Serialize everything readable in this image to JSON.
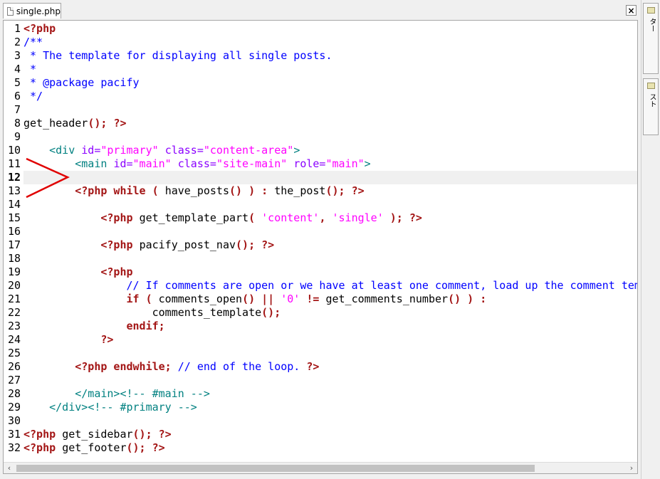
{
  "tab": {
    "filename": "single.php",
    "icon": "file-icon",
    "close_label": "×"
  },
  "side_panel": {
    "tabs": [
      {
        "label": "ファイルセレクター",
        "icon": "folder-icon"
      },
      {
        "label": "ファイルリスト",
        "icon": "folder-icon"
      }
    ]
  },
  "editor": {
    "current_line": 12,
    "annotation": {
      "shape": "red-arrow-pointing-right",
      "color": "#e00000",
      "target_line": 12
    },
    "lines": [
      [
        [
          "kw",
          "<?php"
        ]
      ],
      [
        [
          "cm",
          "/**"
        ]
      ],
      [
        [
          "cm",
          " * The template for displaying all single posts."
        ]
      ],
      [
        [
          "cm",
          " *"
        ]
      ],
      [
        [
          "cm",
          " * @package pacify"
        ]
      ],
      [
        [
          "cm",
          " */"
        ]
      ],
      [],
      [
        [
          "fn",
          "get_header"
        ],
        [
          "kw",
          "();"
        ],
        [
          "pl",
          " "
        ],
        [
          "kw",
          "?>"
        ]
      ],
      [],
      [
        [
          "pl",
          "    "
        ],
        [
          "tag",
          "<div "
        ],
        [
          "attr",
          "id="
        ],
        [
          "str",
          "\"primary\""
        ],
        [
          "pl",
          " "
        ],
        [
          "attr",
          "class="
        ],
        [
          "str",
          "\"content-area\""
        ],
        [
          "tag",
          ">"
        ]
      ],
      [
        [
          "pl",
          "        "
        ],
        [
          "tag",
          "<main "
        ],
        [
          "attr",
          "id="
        ],
        [
          "str",
          "\"main\""
        ],
        [
          "pl",
          " "
        ],
        [
          "attr",
          "class="
        ],
        [
          "str",
          "\"site-main\""
        ],
        [
          "pl",
          " "
        ],
        [
          "attr",
          "role="
        ],
        [
          "str",
          "\"main\""
        ],
        [
          "tag",
          ">"
        ]
      ],
      [],
      [
        [
          "pl",
          "        "
        ],
        [
          "kw",
          "<?php while ("
        ],
        [
          "pl",
          " "
        ],
        [
          "fn",
          "have_posts"
        ],
        [
          "kw",
          "()"
        ],
        [
          "pl",
          " "
        ],
        [
          "kw",
          ") :"
        ],
        [
          "pl",
          " "
        ],
        [
          "fn",
          "the_post"
        ],
        [
          "kw",
          "();"
        ],
        [
          "pl",
          " "
        ],
        [
          "kw",
          "?>"
        ]
      ],
      [],
      [
        [
          "pl",
          "            "
        ],
        [
          "kw",
          "<?php"
        ],
        [
          "pl",
          " "
        ],
        [
          "fn",
          "get_template_part"
        ],
        [
          "kw",
          "("
        ],
        [
          "pl",
          " "
        ],
        [
          "str",
          "'content'"
        ],
        [
          "kw",
          ","
        ],
        [
          "pl",
          " "
        ],
        [
          "str",
          "'single'"
        ],
        [
          "pl",
          " "
        ],
        [
          "kw",
          ");"
        ],
        [
          "pl",
          " "
        ],
        [
          "kw",
          "?>"
        ]
      ],
      [],
      [
        [
          "pl",
          "            "
        ],
        [
          "kw",
          "<?php"
        ],
        [
          "pl",
          " "
        ],
        [
          "fn",
          "pacify_post_nav"
        ],
        [
          "kw",
          "();"
        ],
        [
          "pl",
          " "
        ],
        [
          "kw",
          "?>"
        ]
      ],
      [],
      [
        [
          "pl",
          "            "
        ],
        [
          "kw",
          "<?php"
        ]
      ],
      [
        [
          "pl",
          "                "
        ],
        [
          "cm",
          "// If comments are open or we have at least one comment, load up the comment template."
        ]
      ],
      [
        [
          "pl",
          "                "
        ],
        [
          "kw",
          "if ("
        ],
        [
          "pl",
          " "
        ],
        [
          "fn",
          "comments_open"
        ],
        [
          "kw",
          "() ||"
        ],
        [
          "pl",
          " "
        ],
        [
          "str",
          "'0'"
        ],
        [
          "pl",
          " "
        ],
        [
          "kw",
          "!="
        ],
        [
          "pl",
          " "
        ],
        [
          "fn",
          "get_comments_number"
        ],
        [
          "kw",
          "() ) :"
        ]
      ],
      [
        [
          "pl",
          "                    "
        ],
        [
          "fn",
          "comments_template"
        ],
        [
          "kw",
          "();"
        ]
      ],
      [
        [
          "pl",
          "                "
        ],
        [
          "kw",
          "endif;"
        ]
      ],
      [
        [
          "pl",
          "            "
        ],
        [
          "kw",
          "?>"
        ]
      ],
      [],
      [
        [
          "pl",
          "        "
        ],
        [
          "kw",
          "<?php endwhile;"
        ],
        [
          "pl",
          " "
        ],
        [
          "cm",
          "// end of the loop."
        ],
        [
          "pl",
          " "
        ],
        [
          "kw",
          "?>"
        ]
      ],
      [],
      [
        [
          "pl",
          "        "
        ],
        [
          "tag",
          "</main>"
        ],
        [
          "tag",
          "<!-- #main -->"
        ]
      ],
      [
        [
          "pl",
          "    "
        ],
        [
          "tag",
          "</div>"
        ],
        [
          "tag",
          "<!-- #primary -->"
        ]
      ],
      [],
      [
        [
          "kw",
          "<?php"
        ],
        [
          "pl",
          " "
        ],
        [
          "fn",
          "get_sidebar"
        ],
        [
          "kw",
          "();"
        ],
        [
          "pl",
          " "
        ],
        [
          "kw",
          "?>"
        ]
      ],
      [
        [
          "kw",
          "<?php"
        ],
        [
          "pl",
          " "
        ],
        [
          "fn",
          "get_footer"
        ],
        [
          "kw",
          "();"
        ],
        [
          "pl",
          " "
        ],
        [
          "kw",
          "?>"
        ]
      ]
    ]
  },
  "scrollbar": {
    "left_arrow": "‹",
    "right_arrow": "›"
  }
}
